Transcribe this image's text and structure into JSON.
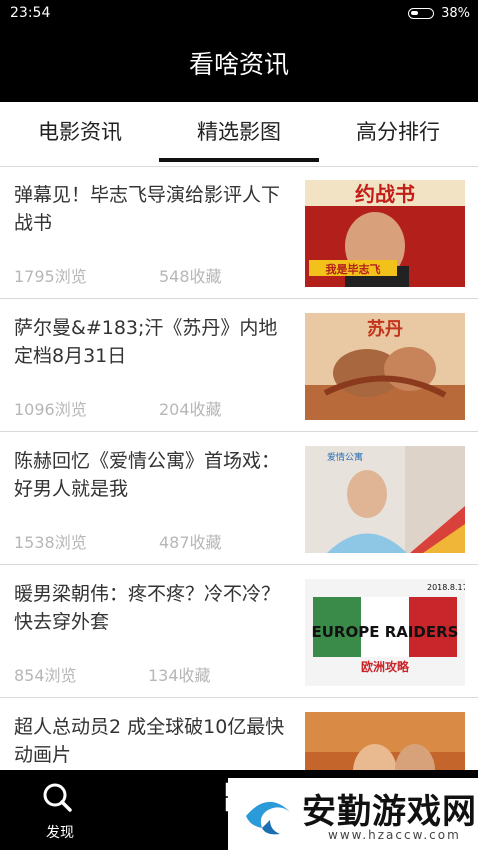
{
  "status": {
    "time": "23:54",
    "battery": "38%",
    "battery_level": 0.38
  },
  "header": {
    "title": "看啥资讯"
  },
  "tabs": [
    {
      "label": "电影资讯",
      "active": false
    },
    {
      "label": "精选影图",
      "active": true
    },
    {
      "label": "高分排行",
      "active": false
    }
  ],
  "articles": [
    {
      "title": "弹幕见！毕志飞导演给影评人下战书",
      "views": "1795浏览",
      "favorites": "548收藏",
      "poster_text": "约战书",
      "poster_text2": "我是毕志飞"
    },
    {
      "title": "萨尔曼&#183;汗《苏丹》内地定档8月31日",
      "views": "1096浏览",
      "favorites": "204收藏",
      "poster_text": "苏丹"
    },
    {
      "title": "陈赫回忆《爱情公寓》首场戏：好男人就是我",
      "views": "1538浏览",
      "favorites": "487收藏",
      "poster_text": "爱情公寓"
    },
    {
      "title": "暖男梁朝伟：疼不疼？冷不冷？快去穿外套",
      "views": "854浏览",
      "favorites": "134收藏",
      "poster_text": "EUROPE RAIDERS",
      "poster_text2": "2018.8.17",
      "poster_text3": "欧洲攻略"
    },
    {
      "title": "超人总动员2  成全球破10亿最快动画片",
      "views": "",
      "favorites": "",
      "poster_text": ""
    }
  ],
  "bottom_nav": [
    {
      "label": "发现",
      "icon": "search-icon"
    },
    {
      "label": "",
      "icon": "grid-icon"
    },
    {
      "label": "",
      "icon": "user-icon"
    }
  ],
  "watermark": {
    "title": "安勤游戏网",
    "url": "www.hzaccw.com"
  },
  "colors": {
    "bar": "#000000",
    "meta_text": "#b7b7b7",
    "divider": "#d9d9d9"
  }
}
